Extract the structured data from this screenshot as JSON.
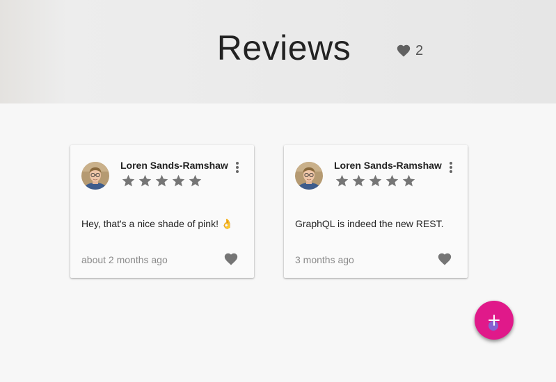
{
  "header": {
    "title": "Reviews",
    "favorite_count": "2",
    "favorite_icon": "heart-icon"
  },
  "colors": {
    "accent": "#e0198a",
    "icon_gray": "#757575",
    "header_bg": "#e9e9e9",
    "page_bg": "#f7f7f7"
  },
  "reviews": [
    {
      "author": "Loren Sands-Ramshaw",
      "rating": 5,
      "text": "Hey, that's a nice shade of pink! 👌",
      "time": "about 2 months ago"
    },
    {
      "author": "Loren Sands-Ramshaw",
      "rating": 5,
      "text": "GraphQL is indeed the new REST.",
      "time": "3 months ago"
    }
  ],
  "fab": {
    "icon": "plus-icon"
  }
}
